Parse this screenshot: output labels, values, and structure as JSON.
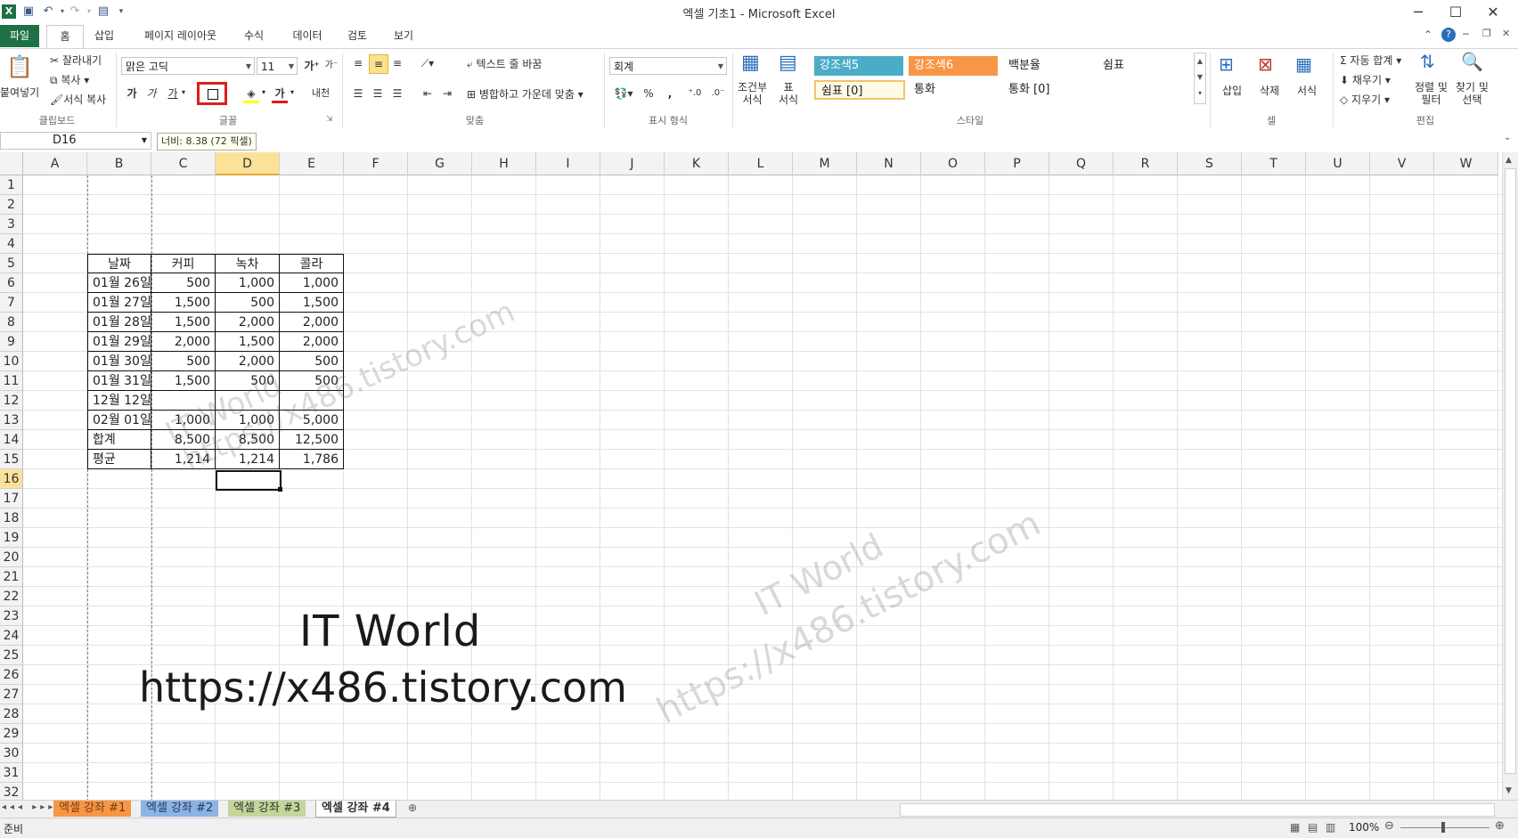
{
  "window": {
    "title": "엑셀 기초1  -  Microsoft Excel",
    "min_label": "─",
    "max_label": "☐",
    "close_label": "✕"
  },
  "qat": {
    "excel_icon": "X",
    "save_icon": "💾",
    "undo_icon": "↶",
    "redo_icon": "↷"
  },
  "tabs": [
    {
      "label": "파일"
    },
    {
      "label": "홈"
    },
    {
      "label": "삽입"
    },
    {
      "label": "페이지 레이아웃"
    },
    {
      "label": "수식"
    },
    {
      "label": "데이터"
    },
    {
      "label": "검토"
    },
    {
      "label": "보기"
    }
  ],
  "ribbon": {
    "clipboard": {
      "paste": "붙여넣기",
      "cut": "잘라내기",
      "copy": "복사",
      "format_painter": "서식 복사",
      "group": "클립보드"
    },
    "font": {
      "family": "맑은 고딕",
      "size": "11",
      "bold": "가",
      "italic": "가",
      "underline": "가",
      "font_color": "가",
      "phonetic": "내천",
      "grow": "가",
      "group": "글꼴"
    },
    "alignment": {
      "wrap": "텍스트 줄 바꿈",
      "merge": "병합하고 가운데 맞춤",
      "group": "맞춤"
    },
    "number": {
      "format": "회계",
      "percent": "%",
      "comma": ",",
      "group": "표시 형식"
    },
    "styles": {
      "conditional": "조건부\n서식",
      "table": "표\n서식",
      "cells": [
        "강조색5",
        "강조색6",
        "백분율",
        "쉼표",
        "쉼표 [0]",
        "통화",
        "통화 [0]"
      ],
      "accent5_color": "#4bacc6",
      "accent6_color": "#f79646",
      "group": "스타일"
    },
    "cells_group": {
      "insert": "삽입",
      "delete": "삭제",
      "format": "서식",
      "group": "셀"
    },
    "editing": {
      "autosum": "자동 합계",
      "fill": "채우기",
      "clear": "지우기",
      "sort": "정렬 및\n필터",
      "find": "찾기 및\n선택",
      "group": "편집"
    }
  },
  "formula_bar": {
    "name_box": "D16",
    "tooltip": "너비: 8.38 (72 픽셀)"
  },
  "grid": {
    "columns": [
      "A",
      "B",
      "C",
      "D",
      "E",
      "F",
      "G",
      "H",
      "I",
      "J",
      "K",
      "L",
      "M",
      "N",
      "O",
      "P",
      "Q",
      "R",
      "S",
      "T",
      "U",
      "V",
      "W"
    ],
    "selected_column": "D",
    "selected_row": "16",
    "rows": [
      "1",
      "2",
      "3",
      "4",
      "5",
      "6",
      "7",
      "8",
      "9",
      "10",
      "11",
      "12",
      "13",
      "14",
      "15",
      "16",
      "17",
      "18",
      "19",
      "20",
      "21",
      "22",
      "23",
      "24",
      "25",
      "26",
      "27",
      "28",
      "29",
      "30",
      "31",
      "32"
    ]
  },
  "table": {
    "headers": [
      "날짜",
      "커피",
      "녹차",
      "콜라"
    ],
    "rows": [
      [
        "01월 26일",
        "500",
        "1,000",
        "1,000"
      ],
      [
        "01월 27일",
        "1,500",
        "500",
        "1,500"
      ],
      [
        "01월 28일",
        "1,500",
        "2,000",
        "2,000"
      ],
      [
        "01월 29일",
        "2,000",
        "1,500",
        "2,000"
      ],
      [
        "01월 30일",
        "500",
        "2,000",
        "500"
      ],
      [
        "01월 31일",
        "1,500",
        "500",
        "500"
      ],
      [
        "12월 12일",
        "",
        "",
        ""
      ],
      [
        "02월 01일",
        "1,000",
        "1,000",
        "5,000"
      ],
      [
        "합계",
        "8,500",
        "8,500",
        "12,500"
      ],
      [
        "평균",
        "1,214",
        "1,214",
        "1,786"
      ]
    ]
  },
  "watermark": {
    "line1": "IT World",
    "line2": "https://x486.tistory.com"
  },
  "sheets": [
    "엑셀 강좌 #1",
    "엑셀 강좌 #2",
    "엑셀 강좌 #3",
    "엑셀 강좌 #4"
  ],
  "sheet_colors": [
    "#f79646",
    "#8db3e2",
    "#c3d69b",
    "#ffffff"
  ],
  "status": {
    "ready": "준비",
    "zoom": "100%"
  }
}
